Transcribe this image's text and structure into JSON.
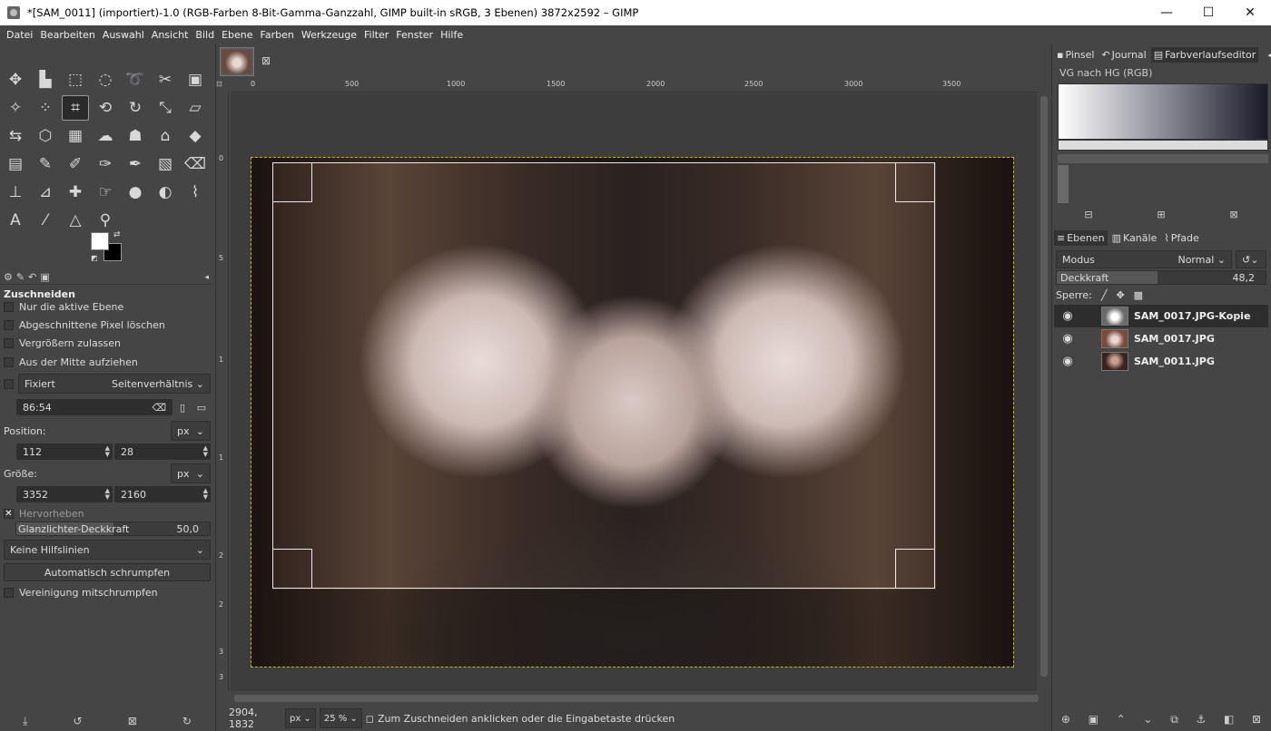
{
  "window": {
    "title": "*[SAM_0011] (importiert)-1.0 (RGB-Farben 8-Bit-Gamma-Ganzzahl, GIMP built-in sRGB, 3 Ebenen) 3872x2592 – GIMP",
    "minimize": "—",
    "maximize": "☐",
    "close": "✕"
  },
  "menu": [
    "Datei",
    "Bearbeiten",
    "Auswahl",
    "Ansicht",
    "Bild",
    "Ebene",
    "Farben",
    "Werkzeuge",
    "Filter",
    "Fenster",
    "Hilfe"
  ],
  "tool_options": {
    "title": "Zuschneiden",
    "only_active_layer": "Nur die aktive Ebene",
    "delete_cropped": "Abgeschnittene Pixel löschen",
    "allow_growing": "Vergrößern zulassen",
    "expand_from_center": "Aus der Mitte aufziehen",
    "fixed": "Fixiert",
    "fixed_mode": "Seitenverhältnis",
    "ratio": "86:54",
    "position_label": "Position:",
    "position_unit": "px",
    "position_x": "112",
    "position_y": "28",
    "size_label": "Größe:",
    "size_unit": "px",
    "size_w": "3352",
    "size_h": "2160",
    "highlight": "Hervorheben",
    "highlight_opacity_label": "Glanzlichter-Deckkraft",
    "highlight_opacity_value": "50,0",
    "guides": "Keine Hilfslinien",
    "auto_shrink": "Automatisch schrumpfen",
    "shrink_merged": "Vereinigung mitschrumpfen"
  },
  "rulers": {
    "h": [
      "0",
      "500",
      "1000",
      "1500",
      "2000",
      "2500",
      "3000",
      "3500"
    ],
    "v": [
      "0",
      "5",
      "1",
      "1",
      "2",
      "2",
      "3",
      "3"
    ]
  },
  "status": {
    "coords": "2904, 1832",
    "unit": "px",
    "zoom": "25 %",
    "message": "Zum Zuschneiden anklicken oder die Eingabetaste drücken"
  },
  "dock_top": {
    "tabs": [
      "Pinsel",
      "Journal",
      "Farbverlaufseditor"
    ],
    "gradient_name": "VG nach HG (RGB)"
  },
  "dock_layers": {
    "tabs": [
      "Ebenen",
      "Kanäle",
      "Pfade"
    ],
    "mode_label": "Modus",
    "mode_value": "Normal",
    "opacity_label": "Deckkraft",
    "opacity_value": "48,2",
    "opacity_fraction": 0.482,
    "lock_label": "Sperre:",
    "layers": [
      {
        "name": "SAM_0017.JPG-Kopie",
        "selected": true
      },
      {
        "name": "SAM_0017.JPG",
        "selected": false
      },
      {
        "name": "SAM_0011.JPG",
        "selected": false
      }
    ]
  },
  "colors": {
    "selection_marching": "#c8b400",
    "fg": "#ffffff",
    "bg": "#000000"
  }
}
